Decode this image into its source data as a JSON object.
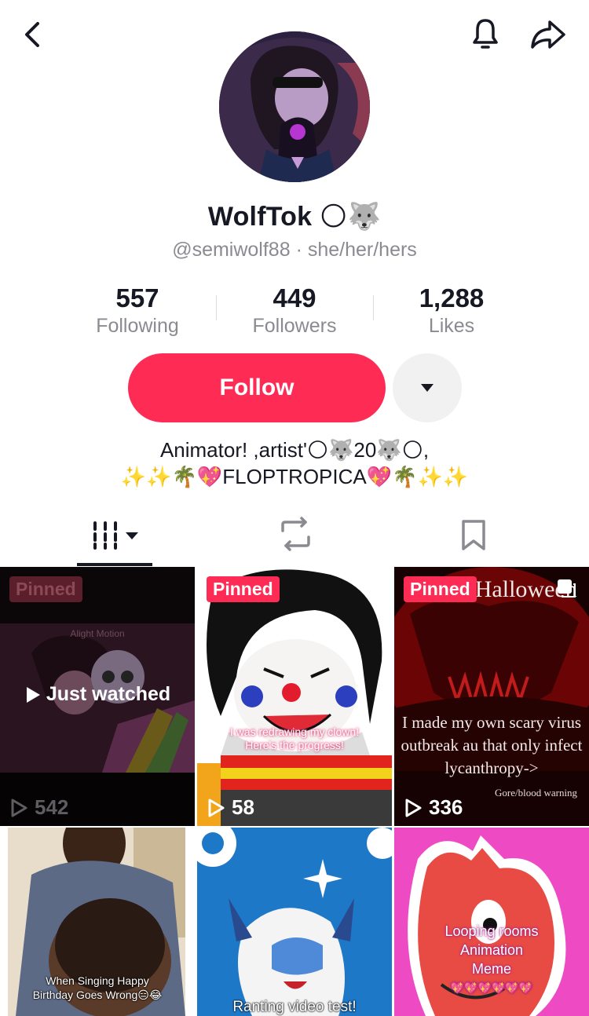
{
  "profile": {
    "display_name": "WolfTok",
    "name_emojis": "🌕🐺",
    "handle": "@semiwolf88",
    "pronouns": "she/her/hers",
    "handle_separator": " · "
  },
  "stats": {
    "following": {
      "value": "557",
      "label": "Following"
    },
    "followers": {
      "value": "449",
      "label": "Followers"
    },
    "likes": {
      "value": "1,288",
      "label": "Likes"
    }
  },
  "actions": {
    "follow_label": "Follow"
  },
  "bio": {
    "line1": "Animator! ,artist'🌕🐺20🐺🌕,",
    "line2": "✨✨🌴💖FLOPTROPICA💖🌴✨✨"
  },
  "tabs": [
    "videos",
    "reposts",
    "favorites"
  ],
  "colors": {
    "accent": "#fe2c55",
    "text": "#161823",
    "secondary_text": "#8a8b91"
  },
  "videos": [
    {
      "pinned_label": "Pinned",
      "views": "542",
      "overlay": "Just watched",
      "watermark": "Alight Motion"
    },
    {
      "pinned_label": "Pinned",
      "views": "58",
      "caption_line1": "I was redrawing my clown!",
      "caption_line2": "Here's the progress!"
    },
    {
      "pinned_label": "Pinned",
      "views": "336",
      "title": "Happy Halloween",
      "caption_line1": "I made my own scary virus",
      "caption_line2": "outbreak au that only infect",
      "caption_line3": "lycanthropy->",
      "warning": "Gore/blood warning"
    },
    {
      "caption_line1": "When Singing Happy",
      "caption_line2": "Birthday Goes Wrong😑😂"
    },
    {
      "caption_line1": "Ranting video test!"
    },
    {
      "caption_line1": "Looping rooms",
      "caption_line2": "Animation",
      "caption_line3": "Meme",
      "caption_line4": "💖💖💖💖💖💖"
    }
  ]
}
